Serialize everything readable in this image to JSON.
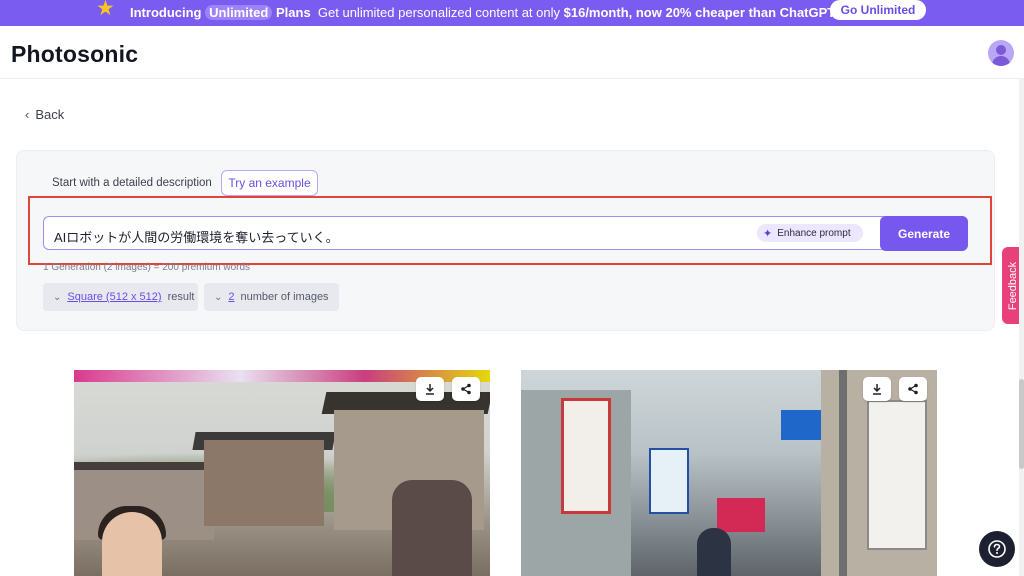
{
  "banner": {
    "intro": "Introducing",
    "highlight": "Unlimited",
    "plans": "Plans",
    "message_prefix": "Get unlimited personalized content at only",
    "price": "$16/month, now 20% cheaper than ChatGPT.",
    "cta_label": "Go Unlimited",
    "icon": "star-icon",
    "color": "#7b5cf0"
  },
  "header": {
    "title": "Photosonic",
    "avatar_icon": "user-avatar-icon"
  },
  "nav": {
    "back_label": "Back"
  },
  "prompt_panel": {
    "start_label": "Start with a detailed description",
    "example_button": "Try an example",
    "prompt_value": "AIロボットが人間の労働環境を奪い去っていく。",
    "enhance_label": "Enhance prompt",
    "generate_label": "Generate",
    "generation_info": "1 Generation (2 images) = 200 premium words",
    "size_select": {
      "value": "Square (512 x 512)",
      "suffix": "result"
    },
    "count_select": {
      "value": "2",
      "suffix": "number of images"
    },
    "accent_color": "#7658ee",
    "highlight_border_color": "#e0453a"
  },
  "results": [
    {
      "name": "generated-image-1",
      "download_icon": "download-icon",
      "share_icon": "share-icon"
    },
    {
      "name": "generated-image-2",
      "download_icon": "download-icon",
      "share_icon": "share-icon"
    }
  ],
  "side": {
    "feedback_label": "Feedback",
    "feedback_color": "#e8407a",
    "help_icon": "help-question-icon"
  }
}
